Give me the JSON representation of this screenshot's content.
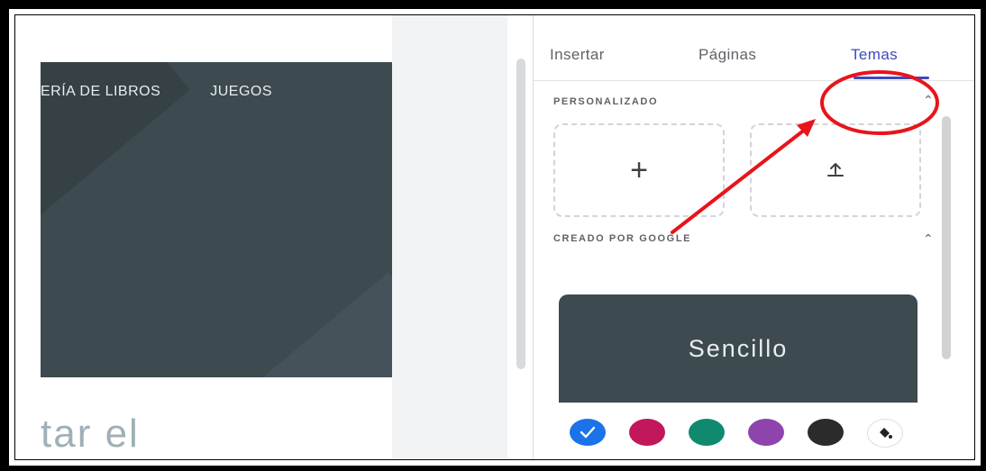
{
  "preview": {
    "nav": [
      "ERÍA DE LIBROS",
      "JUEGOS"
    ],
    "big_text": "tar el"
  },
  "panel": {
    "tabs": [
      {
        "label": "Insertar",
        "active": false
      },
      {
        "label": "Páginas",
        "active": false
      },
      {
        "label": "Temas",
        "active": true
      }
    ],
    "sections": {
      "custom": {
        "label": "PERSONALIZADO"
      },
      "google": {
        "label": "CREADO POR GOOGLE"
      }
    },
    "custom_tiles": [
      {
        "icon": "plus-icon",
        "glyph": "+"
      },
      {
        "icon": "upload-icon",
        "glyph": "⤒"
      }
    ],
    "theme": {
      "name": "Sencillo",
      "swatches": [
        {
          "color": "#1a73e8",
          "selected": true
        },
        {
          "color": "#c2185b",
          "selected": false
        },
        {
          "color": "#0f8a6f",
          "selected": false
        },
        {
          "color": "#8e44ad",
          "selected": false
        },
        {
          "color": "#2b2b2b",
          "selected": false
        }
      ],
      "fill_icon": "paint-bucket-icon"
    }
  },
  "colors": {
    "accent": "#3c4bbf",
    "hero": "#3d4a50",
    "annotation": "#e8141b"
  }
}
